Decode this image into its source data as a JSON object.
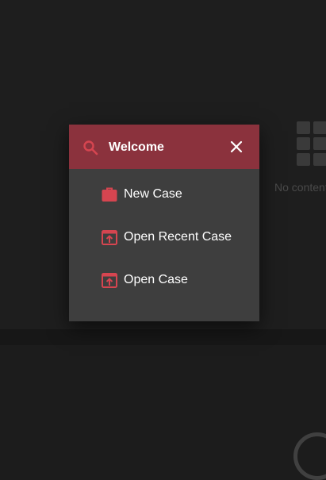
{
  "background": {
    "empty_state_text": "No content"
  },
  "dialog": {
    "title": "Welcome",
    "header_color": "#8b323d",
    "accent_color": "#d64550",
    "search_icon": "search-icon",
    "close_icon": "close-icon",
    "items": [
      {
        "label": "New Case",
        "icon": "briefcase-icon"
      },
      {
        "label": "Open Recent Case",
        "icon": "open-in-icon"
      },
      {
        "label": "Open Case",
        "icon": "open-in-icon"
      }
    ]
  }
}
